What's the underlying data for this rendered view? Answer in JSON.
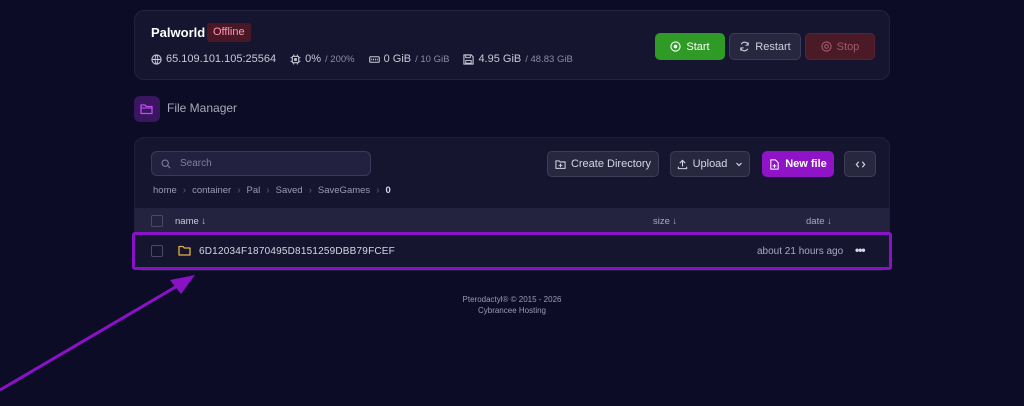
{
  "server": {
    "name": "Palworld",
    "status": "Offline",
    "address": "65.109.101.105:25564",
    "cpu": "0%",
    "cpu_limit": "/ 200%",
    "memory": "0 GiB",
    "memory_limit": "/ 10 GiB",
    "disk": "4.95 GiB",
    "disk_limit": "/ 48.83 GiB"
  },
  "power": {
    "start_label": "Start",
    "restart_label": "Restart",
    "stop_label": "Stop"
  },
  "file_manager": {
    "title": "File Manager",
    "search_placeholder": "Search",
    "create_directory_label": "Create Directory",
    "upload_label": "Upload",
    "new_file_label": "New file",
    "breadcrumb": [
      "home",
      "container",
      "Pal",
      "Saved",
      "SaveGames",
      "0"
    ],
    "columns": {
      "name": "name ↓",
      "size": "size ↓",
      "date": "date ↓"
    },
    "files": [
      {
        "name": "6D12034F1870495D8151259DBB79FCEF",
        "type": "folder",
        "date": "about 21 hours ago",
        "menu": "•••"
      }
    ]
  },
  "footer": {
    "line1": "Pterodactyl® © 2015 - 2026",
    "line2": "Cybrancee Hosting"
  },
  "colors": {
    "background": "#0c0c26",
    "accent": "#8f14c8",
    "start": "#2f9a25",
    "offline_badge": "#4a1727",
    "folder": "#e3b23c",
    "annotation": "#8a12c6"
  }
}
